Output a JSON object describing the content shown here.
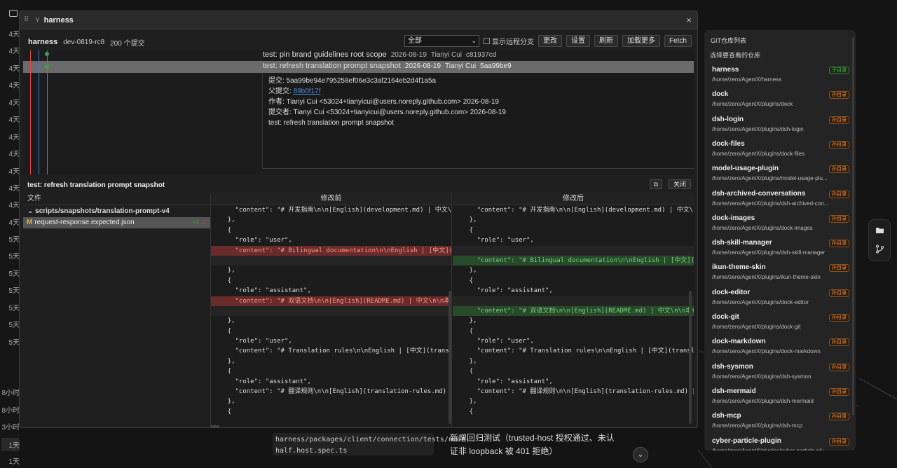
{
  "background": {
    "ages": [
      "4天",
      "4天",
      "4天",
      "4天",
      "4天",
      "4天",
      "4天",
      "4天",
      "4天",
      "4天",
      "4天",
      "4天",
      "5天",
      "5天",
      "5天",
      "5天",
      "5天",
      "5天",
      "5天",
      "8小时",
      "8小时",
      "3小时",
      "1天",
      "1天"
    ],
    "code_path": "harness/packages/client/connection/tests/node-half.host.spec.ts",
    "note": "新增回归测试（trusted-host 授权通过、未认证非 loopback 被 401 拒绝）"
  },
  "dialog": {
    "title": "harness",
    "close": "×"
  },
  "toolbar": {
    "repo": "harness",
    "branch": "dev-0819-rc8",
    "count": "200 个提交",
    "filter_value": "全部",
    "show_remote": "显示远程分支",
    "btn_changes": "更改",
    "btn_settings": "设置",
    "btn_refresh": "刷新",
    "btn_load_more": "加载更多",
    "btn_fetch": "Fetch"
  },
  "commits": [
    {
      "msg": "test: pin brand guidelines root scope",
      "date": "2026-08-19",
      "author": "Tianyi Cui",
      "hash": "c81937cd"
    },
    {
      "msg": "test: refresh translation prompt snapshot",
      "date": "2026-08-19",
      "author": "Tianyi Cui",
      "hash": "5aa99be9"
    }
  ],
  "detail": {
    "commit": "提交: 5aa99be94e795258ef06e3c3af2164eb2d4f1a5a",
    "parent_label": "父提交:",
    "parent": "89b0f17f",
    "author": "作者: Tianyi Cui <53024+tianyicui@users.noreply.github.com> 2026-08-19",
    "committer": "提交者: Tianyi Cui <53024+tianyicui@users.noreply.github.com> 2026-08-19",
    "message": "test: refresh translation prompt snapshot"
  },
  "diff": {
    "title": "test: refresh translation prompt snapshot",
    "copy": "⧉",
    "close": "关闭",
    "files_header": "文件",
    "folder": "scripts/snapshots/translation-prompt-v4",
    "file_status": "M",
    "file": "request-response.expected.json",
    "file_plus": "+2",
    "file_minus": "-2",
    "before_header": "修改前",
    "after_header": "修改后",
    "before_lines": [
      {
        "t": "n",
        "text": "      \"content\": \"# 开发指南\\n\\n[English](development.md) | 中文\\n\\n本"
      },
      {
        "t": "n",
        "text": "    },"
      },
      {
        "t": "n",
        "text": "    {"
      },
      {
        "t": "n",
        "text": "      \"role\": \"user\","
      },
      {
        "t": "d",
        "text": "      \"content\": \"# Bilingual documentation\\n\\nEnglish | [中文](README"
      },
      {
        "t": "b",
        "text": ""
      },
      {
        "t": "n",
        "text": "    },"
      },
      {
        "t": "n",
        "text": "    {"
      },
      {
        "t": "n",
        "text": "      \"role\": \"assistant\","
      },
      {
        "t": "d",
        "text": "      \"content\": \"# 双语文档\\n\\n[English](README.md) | 中文\\n\\n本仓库"
      },
      {
        "t": "b",
        "text": ""
      },
      {
        "t": "n",
        "text": "    },"
      },
      {
        "t": "n",
        "text": "    {"
      },
      {
        "t": "n",
        "text": "      \"role\": \"user\","
      },
      {
        "t": "n",
        "text": "      \"content\": \"# Translation rules\\n\\nEnglish | [中文](translation"
      },
      {
        "t": "n",
        "text": "    },"
      },
      {
        "t": "n",
        "text": "    {"
      },
      {
        "t": "n",
        "text": "      \"role\": \"assistant\","
      },
      {
        "t": "n",
        "text": "      \"content\": \"# 翻译规则\\n\\n[English](translation-rules.md) | 中文"
      },
      {
        "t": "n",
        "text": "    },"
      },
      {
        "t": "n",
        "text": "    {"
      }
    ],
    "after_lines": [
      {
        "t": "n",
        "text": "      \"content\": \"# 开发指南\\n\\n[English](development.md) | 中文\\n\\n本"
      },
      {
        "t": "n",
        "text": "    },"
      },
      {
        "t": "n",
        "text": "    {"
      },
      {
        "t": "n",
        "text": "      \"role\": \"user\","
      },
      {
        "t": "b",
        "text": ""
      },
      {
        "t": "a",
        "text": "      \"content\": \"# Bilingual documentation\\n\\nEnglish | [中文](README"
      },
      {
        "t": "n",
        "text": "    },"
      },
      {
        "t": "n",
        "text": "    {"
      },
      {
        "t": "n",
        "text": "      \"role\": \"assistant\","
      },
      {
        "t": "b",
        "text": ""
      },
      {
        "t": "a",
        "text": "      \"content\": \"# 双语文档\\n\\n[English](README.md) | 中文\\n\\n本仓库"
      },
      {
        "t": "n",
        "text": "    },"
      },
      {
        "t": "n",
        "text": "    {"
      },
      {
        "t": "n",
        "text": "      \"role\": \"user\","
      },
      {
        "t": "n",
        "text": "      \"content\": \"# Translation rules\\n\\nEnglish | [中文](translation"
      },
      {
        "t": "n",
        "text": "    },"
      },
      {
        "t": "n",
        "text": "    {"
      },
      {
        "t": "n",
        "text": "      \"role\": \"assistant\","
      },
      {
        "t": "n",
        "text": "      \"content\": \"# 翻译规则\\n\\n[English](translation-rules.md) | 中文"
      },
      {
        "t": "n",
        "text": "    },"
      },
      {
        "t": "n",
        "text": "    {"
      }
    ]
  },
  "repo_panel": {
    "title": "GIT仓库列表",
    "subtitle": "选择要查看的仓库",
    "repos": [
      {
        "name": "harness",
        "path": "/home/zero/AgentX/harness",
        "badge": "子目录",
        "kind": "sub"
      },
      {
        "name": "dock",
        "path": "/home/zero/AgentX/plugins/dock",
        "badge": "孙目录",
        "kind": "grand"
      },
      {
        "name": "dsh-login",
        "path": "/home/zero/AgentX/plugins/dsh-login",
        "badge": "孙目录",
        "kind": "grand"
      },
      {
        "name": "dock-files",
        "path": "/home/zero/AgentX/plugins/dock-files",
        "badge": "孙目录",
        "kind": "grand"
      },
      {
        "name": "model-usage-plugin",
        "path": "/home/zero/AgentX/plugins/model-usage-plu...",
        "badge": "孙目录",
        "kind": "grand"
      },
      {
        "name": "dsh-archived-conversations",
        "path": "/home/zero/AgentX/plugins/dsh-archived-con...",
        "badge": "孙目录",
        "kind": "grand"
      },
      {
        "name": "dock-images",
        "path": "/home/zero/AgentX/plugins/dock-images",
        "badge": "孙目录",
        "kind": "grand"
      },
      {
        "name": "dsh-skill-manager",
        "path": "/home/zero/AgentX/plugins/dsh-skill-manager",
        "badge": "孙目录",
        "kind": "grand"
      },
      {
        "name": "ikun-theme-skin",
        "path": "/home/zero/AgentX/plugins/ikun-theme-skin",
        "badge": "孙目录",
        "kind": "grand"
      },
      {
        "name": "dock-editor",
        "path": "/home/zero/AgentX/plugins/dock-editor",
        "badge": "孙目录",
        "kind": "grand"
      },
      {
        "name": "dock-git",
        "path": "/home/zero/AgentX/plugins/dock-git",
        "badge": "孙目录",
        "kind": "grand"
      },
      {
        "name": "dock-markdown",
        "path": "/home/zero/AgentX/plugins/dock-markdown",
        "badge": "孙目录",
        "kind": "grand"
      },
      {
        "name": "dsh-sysmon",
        "path": "/home/zero/AgentX/plugins/dsh-sysmon",
        "badge": "孙目录",
        "kind": "grand"
      },
      {
        "name": "dsh-mermaid",
        "path": "/home/zero/AgentX/plugins/dsh-mermaid",
        "badge": "孙目录",
        "kind": "grand"
      },
      {
        "name": "dsh-mcp",
        "path": "/home/zero/AgentX/plugins/dsh-mcp",
        "badge": "孙目录",
        "kind": "grand"
      },
      {
        "name": "cyber-particle-plugin",
        "path": "/home/zero/AgentX/plugins/cyber-particle-plu...",
        "badge": "孙目录",
        "kind": "grand"
      }
    ]
  },
  "colors": {
    "graph_red": "#e04848",
    "graph_blue": "#3a7ad8",
    "graph_green": "#3aa050",
    "deleted_bg": "#6a2b2b",
    "added_bg": "#264a2a"
  }
}
